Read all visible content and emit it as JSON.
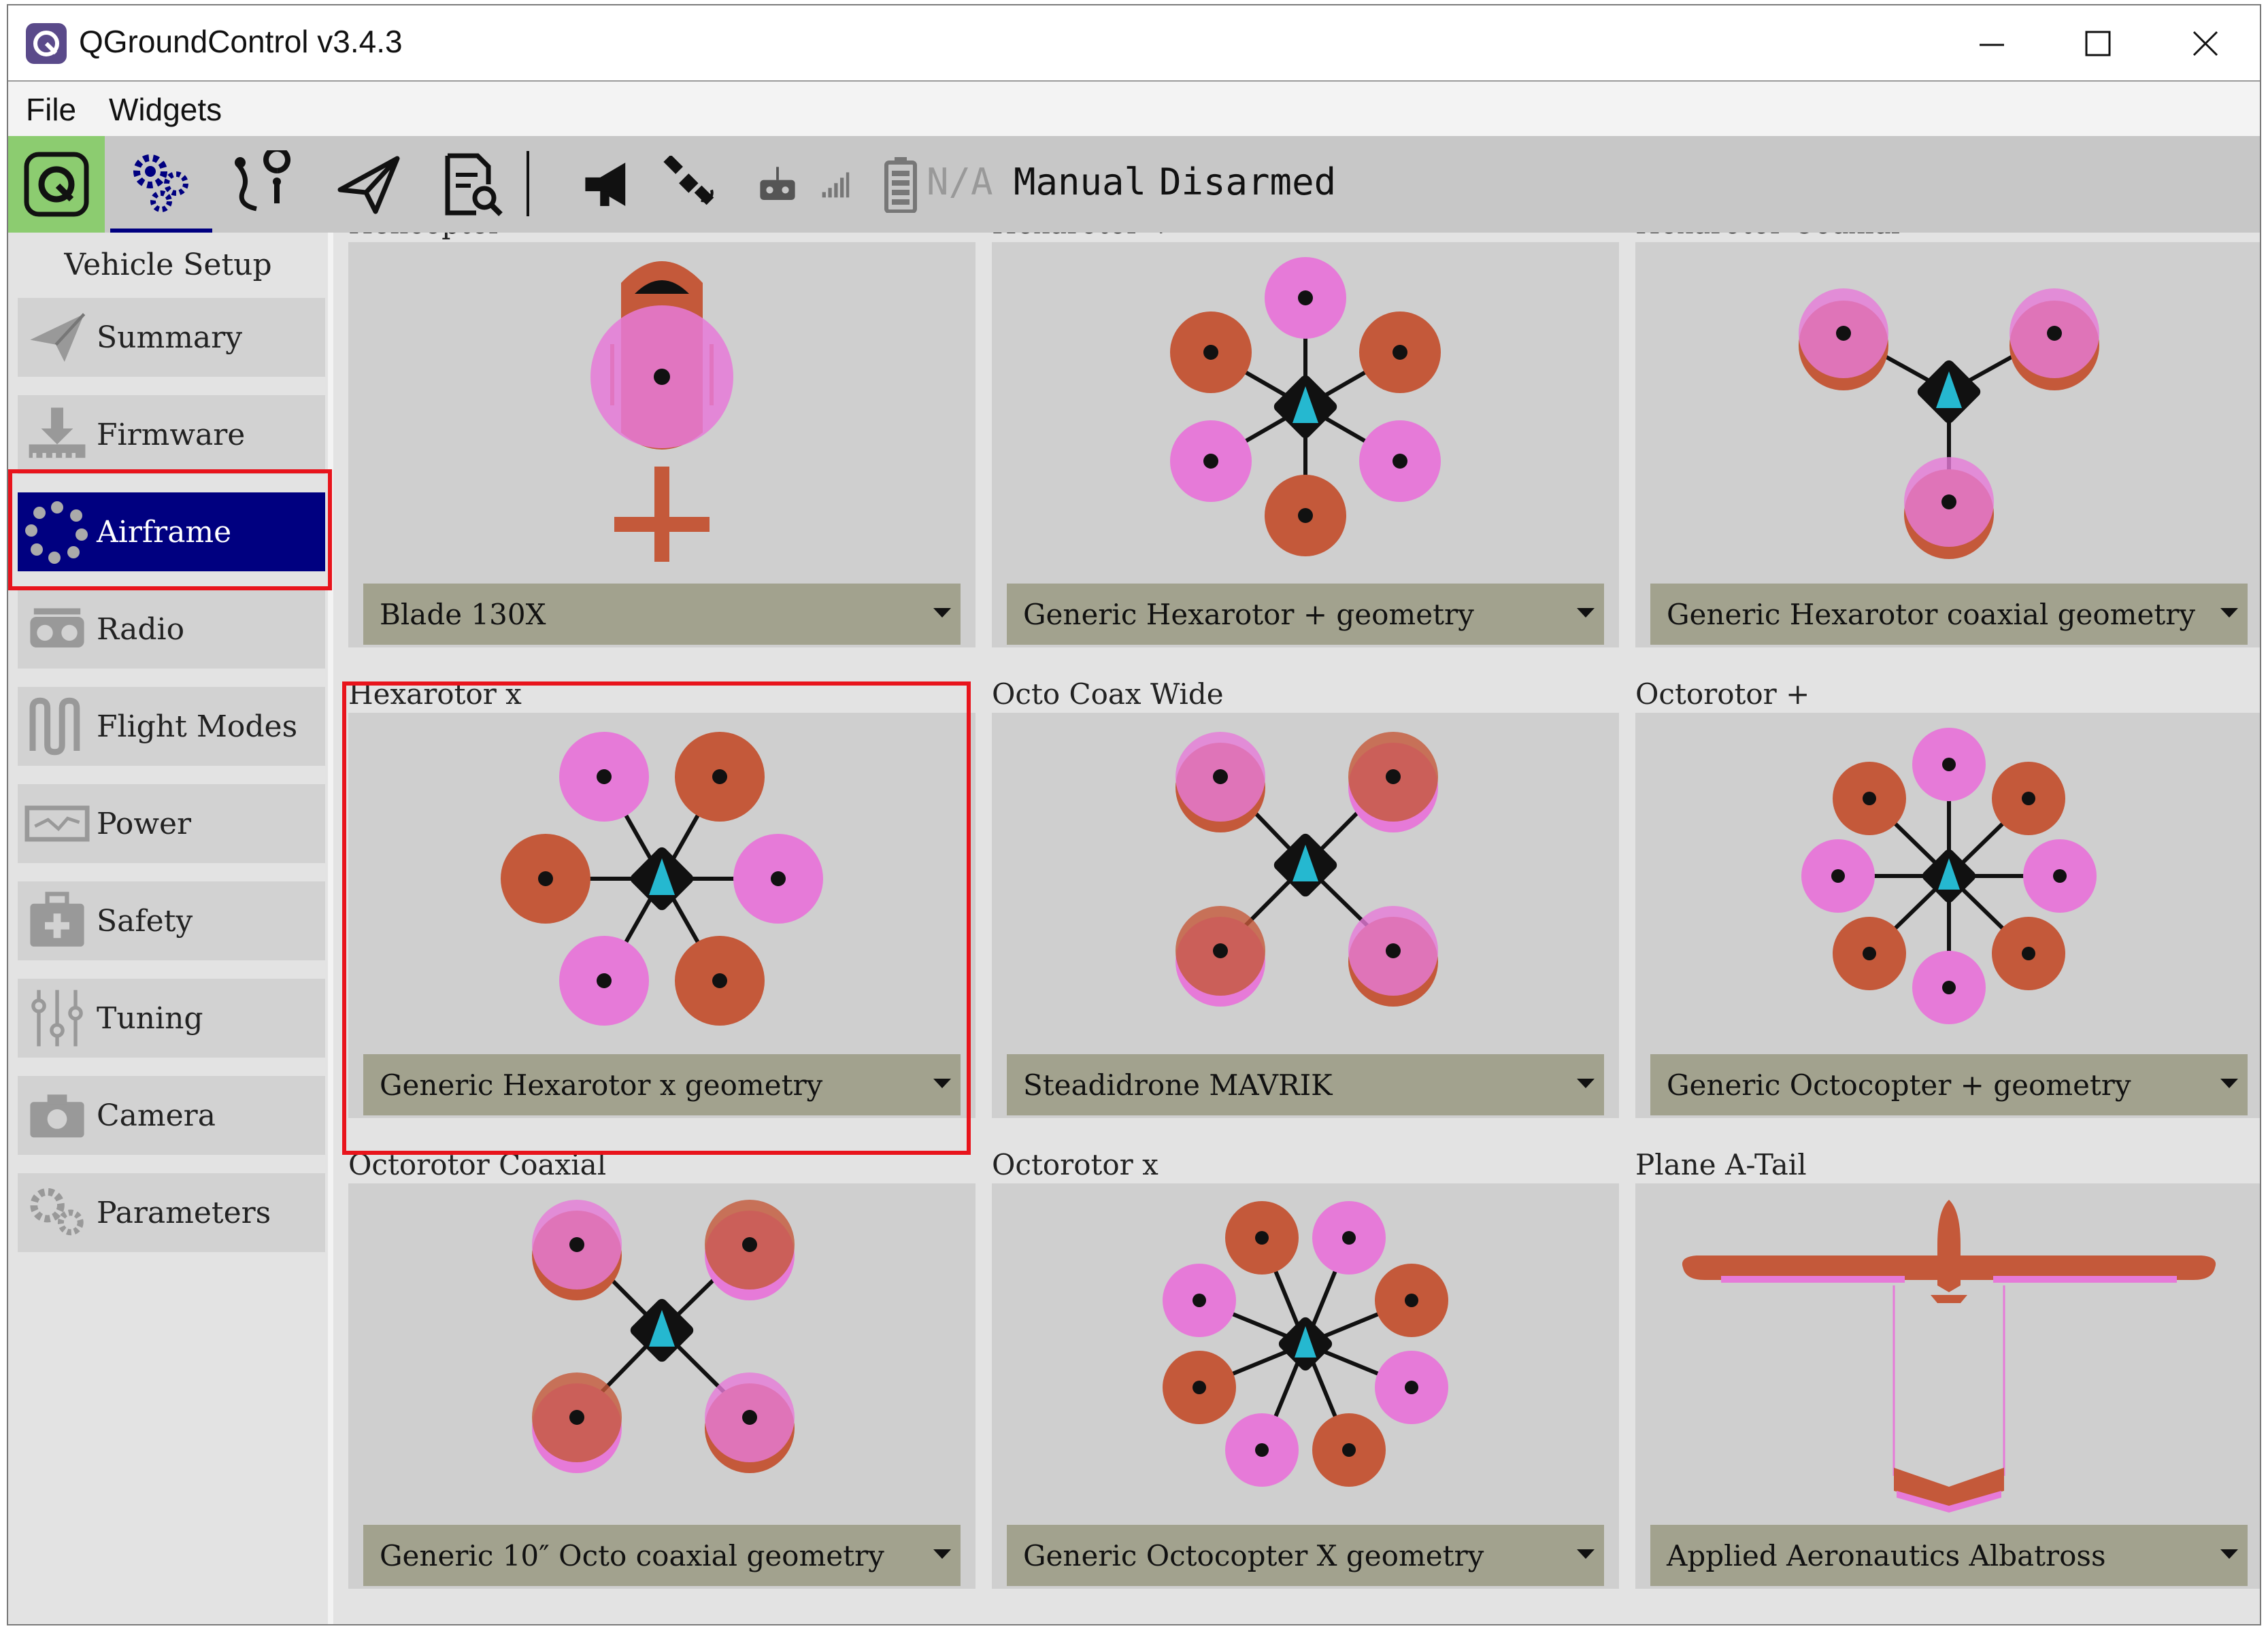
{
  "window": {
    "title": "QGroundControl v3.4.3"
  },
  "menu": {
    "file": "File",
    "widgets": "Widgets"
  },
  "toolbar": {
    "battery": "N/A",
    "flight_mode": "Manual",
    "arm_state": "Disarmed"
  },
  "sidebar": {
    "title": "Vehicle Setup",
    "items": [
      {
        "label": "Summary"
      },
      {
        "label": "Firmware"
      },
      {
        "label": "Airframe"
      },
      {
        "label": "Radio"
      },
      {
        "label": "Flight Modes"
      },
      {
        "label": "Power"
      },
      {
        "label": "Safety"
      },
      {
        "label": "Tuning"
      },
      {
        "label": "Camera"
      },
      {
        "label": "Parameters"
      }
    ]
  },
  "airframes": [
    {
      "name": "Helicopter",
      "selection": "Blade 130X"
    },
    {
      "name": "Hexarotor +",
      "selection": "Generic Hexarotor + geometry"
    },
    {
      "name": "Hexarotor Coaxial",
      "selection": "Generic Hexarotor coaxial geometry"
    },
    {
      "name": "Hexarotor x",
      "selection": "Generic Hexarotor x geometry"
    },
    {
      "name": "Octo Coax Wide",
      "selection": "Steadidrone MAVRIK"
    },
    {
      "name": "Octorotor +",
      "selection": "Generic Octocopter + geometry"
    },
    {
      "name": "Octorotor Coaxial",
      "selection": "Generic 10″ Octo coaxial geometry"
    },
    {
      "name": "Octorotor x",
      "selection": "Generic Octocopter X geometry"
    },
    {
      "name": "Plane A-Tail",
      "selection": "Applied Aeronautics Albatross"
    }
  ],
  "colors": {
    "active_nav": "#000080",
    "highlight": "#e8141c",
    "rotor_cw": "#c4593a",
    "rotor_ccw": "#e67ad8",
    "body": "#111111",
    "heading": "#25b8d0"
  }
}
